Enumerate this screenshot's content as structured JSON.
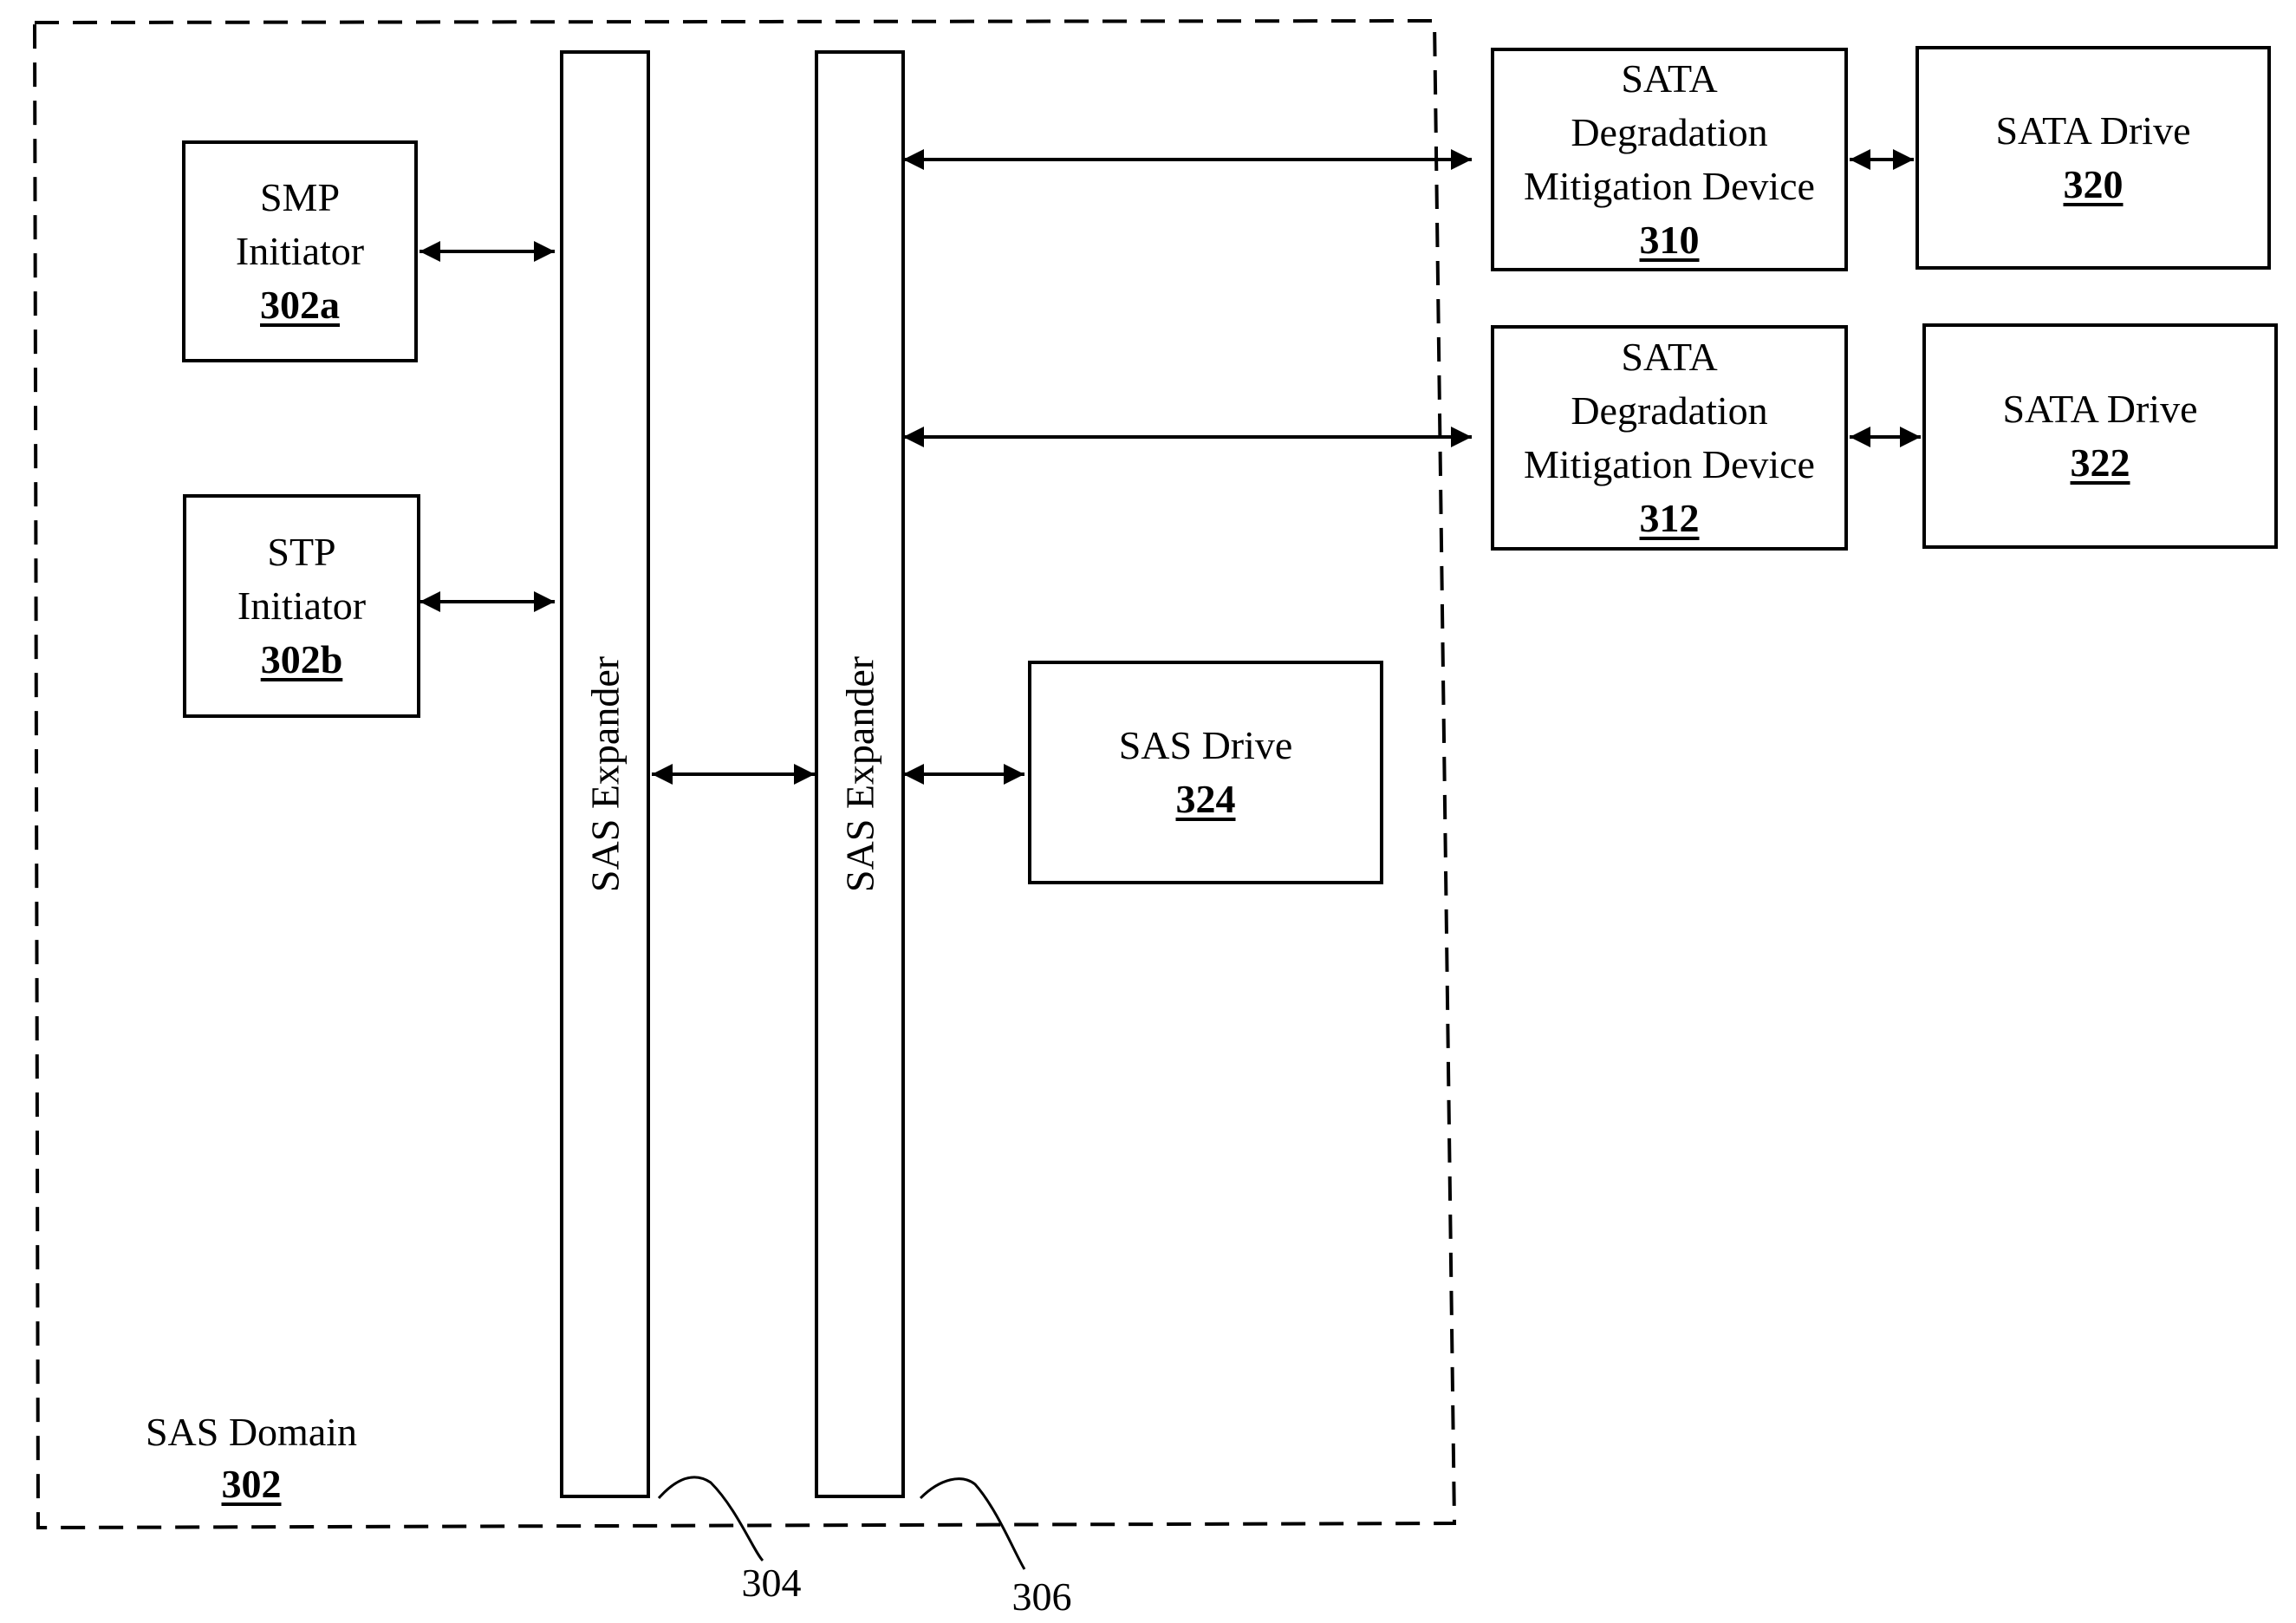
{
  "domain_box": {
    "title": "SAS Domain",
    "ref": "302"
  },
  "initiators": [
    {
      "title_lines": [
        "SMP",
        "Initiator"
      ],
      "ref": "302a"
    },
    {
      "title_lines": [
        "STP",
        "Initiator"
      ],
      "ref": "302b"
    }
  ],
  "expanders": [
    {
      "label": "SAS Expander",
      "ref": "304"
    },
    {
      "label": "SAS Expander",
      "ref": "306"
    }
  ],
  "sas_drive": {
    "title": "SAS Drive",
    "ref": "324"
  },
  "mitigation_devices": [
    {
      "title_lines": [
        "SATA",
        "Degradation",
        "Mitigation Device"
      ],
      "ref": "310"
    },
    {
      "title_lines": [
        "SATA",
        "Degradation",
        "Mitigation Device"
      ],
      "ref": "312"
    }
  ],
  "sata_drives": [
    {
      "title": "SATA Drive",
      "ref": "320"
    },
    {
      "title": "SATA Drive",
      "ref": "322"
    }
  ],
  "connections": [
    {
      "from": "302a",
      "to": "304",
      "type": "bidirectional"
    },
    {
      "from": "302b",
      "to": "304",
      "type": "bidirectional"
    },
    {
      "from": "304",
      "to": "306",
      "type": "bidirectional"
    },
    {
      "from": "306",
      "to": "310",
      "type": "bidirectional"
    },
    {
      "from": "306",
      "to": "312",
      "type": "bidirectional"
    },
    {
      "from": "306",
      "to": "324",
      "type": "bidirectional"
    },
    {
      "from": "310",
      "to": "320",
      "type": "bidirectional"
    },
    {
      "from": "312",
      "to": "322",
      "type": "bidirectional"
    }
  ]
}
